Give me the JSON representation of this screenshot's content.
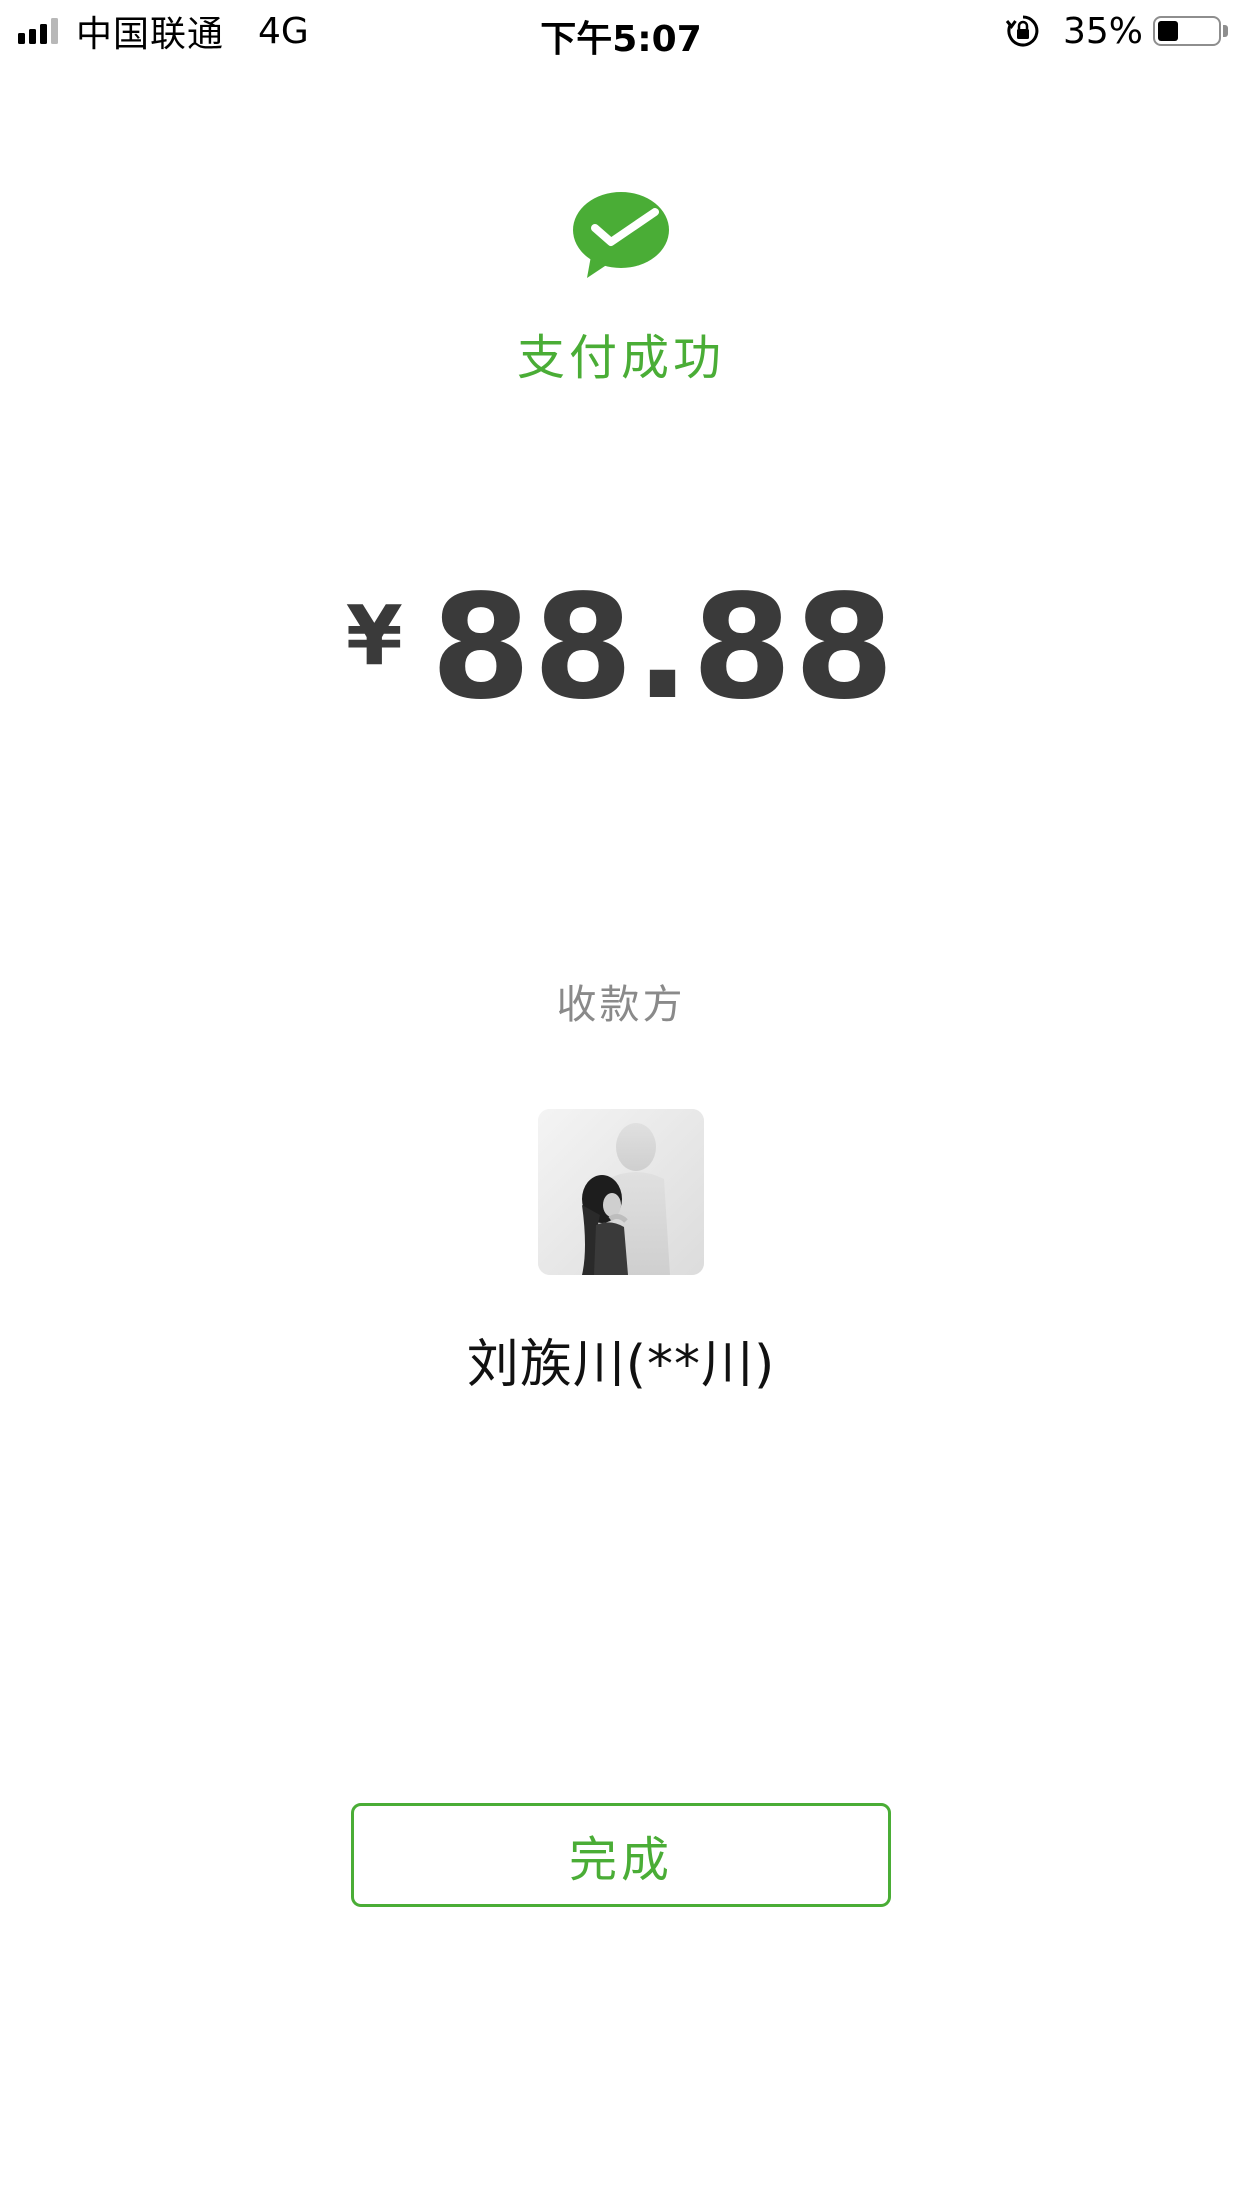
{
  "status_bar": {
    "carrier": "中国联通",
    "network": "4G",
    "time": "下午5:07",
    "battery_percent": "35%",
    "battery_level": 0.35,
    "signal_bars_active": 3,
    "signal_bars_total": 4,
    "icons": [
      "signal-icon",
      "orientation-lock-icon",
      "battery-icon"
    ]
  },
  "header": {
    "icon": "wechat-pay-success-icon",
    "title": "支付成功"
  },
  "payment": {
    "currency_symbol": "¥",
    "amount": "88.88"
  },
  "payee": {
    "label": "收款方",
    "avatar": "payee-avatar",
    "name": "刘族川(**川)"
  },
  "actions": {
    "done_label": "完成"
  },
  "colors": {
    "accent": "#4aad36",
    "amount_text": "#3a3a3a",
    "secondary_text": "#8a8a8a",
    "background": "#ffffff"
  }
}
